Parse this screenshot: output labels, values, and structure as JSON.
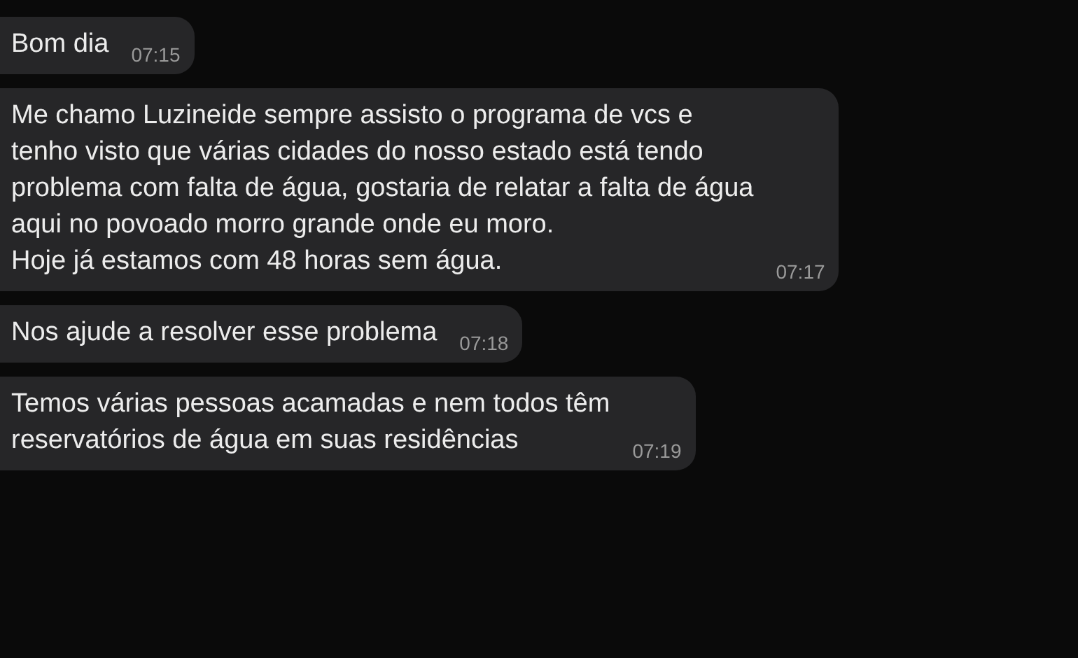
{
  "messages": [
    {
      "text": "Bom dia",
      "time": "07:15"
    },
    {
      "text": "Me chamo Luzineide sempre assisto o programa de vcs e\ntenho visto que várias cidades do nosso estado está tendo\nproblema com falta de água, gostaria de relatar a falta de água\naqui no povoado morro grande onde eu moro.\nHoje já estamos com 48 horas sem água.",
      "time": "07:17"
    },
    {
      "text": "Nos ajude a resolver esse problema",
      "time": "07:18"
    },
    {
      "text": "Temos várias pessoas acamadas e nem todos têm\nreservatórios de água em suas residências",
      "time": "07:19"
    }
  ]
}
